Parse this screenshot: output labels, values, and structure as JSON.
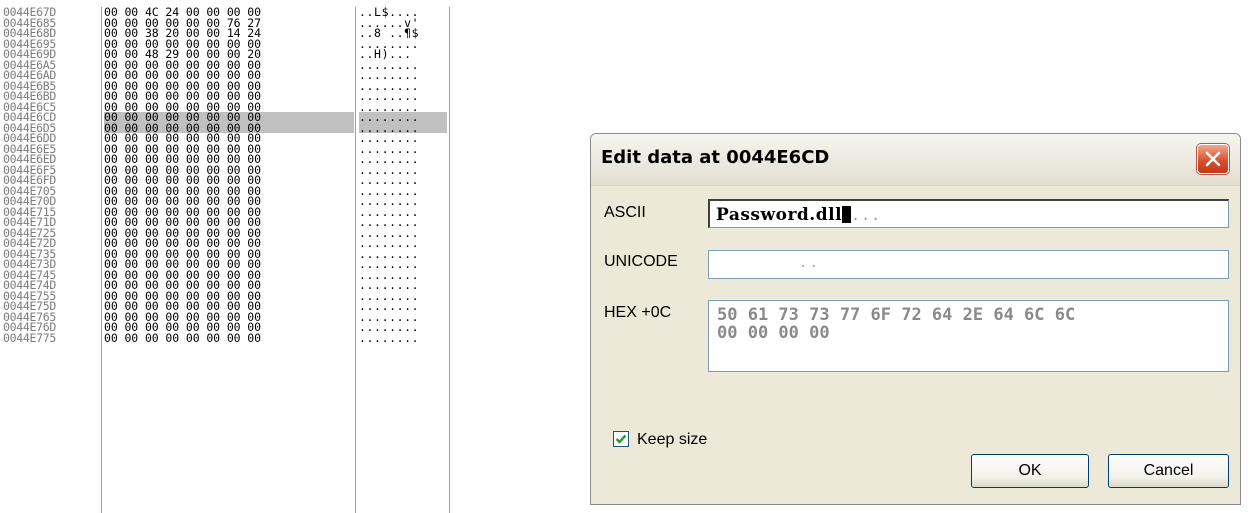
{
  "hex_dump": {
    "rows": [
      {
        "addr": "0044E67D",
        "hex": "00 00 4C 24 00 00 00 00",
        "ascii": "..L$....",
        "selected": false
      },
      {
        "addr": "0044E685",
        "hex": "00 00 00 00 00 00 76 27",
        "ascii": "......v'",
        "selected": false
      },
      {
        "addr": "0044E68D",
        "hex": "00 00 38 20 00 00 14 24",
        "ascii": "..8 ..¶$",
        "selected": false
      },
      {
        "addr": "0044E695",
        "hex": "00 00 00 00 00 00 00 00",
        "ascii": "........",
        "selected": false
      },
      {
        "addr": "0044E69D",
        "hex": "00 00 48 29 00 00 00 20",
        "ascii": "..H)... ",
        "selected": false
      },
      {
        "addr": "0044E6A5",
        "hex": "00 00 00 00 00 00 00 00",
        "ascii": "........",
        "selected": false
      },
      {
        "addr": "0044E6AD",
        "hex": "00 00 00 00 00 00 00 00",
        "ascii": "........",
        "selected": false
      },
      {
        "addr": "0044E6B5",
        "hex": "00 00 00 00 00 00 00 00",
        "ascii": "........",
        "selected": false
      },
      {
        "addr": "0044E6BD",
        "hex": "00 00 00 00 00 00 00 00",
        "ascii": "........",
        "selected": false
      },
      {
        "addr": "0044E6C5",
        "hex": "00 00 00 00 00 00 00 00",
        "ascii": "........",
        "selected": false
      },
      {
        "addr": "0044E6CD",
        "hex": "00 00 00 00 00 00 00 00",
        "ascii": "........",
        "selected": true
      },
      {
        "addr": "0044E6D5",
        "hex": "00 00 00 00 00 00 00 00",
        "ascii": "........",
        "selected": true
      },
      {
        "addr": "0044E6DD",
        "hex": "00 00 00 00 00 00 00 00",
        "ascii": "........",
        "selected": false
      },
      {
        "addr": "0044E6E5",
        "hex": "00 00 00 00 00 00 00 00",
        "ascii": "........",
        "selected": false
      },
      {
        "addr": "0044E6ED",
        "hex": "00 00 00 00 00 00 00 00",
        "ascii": "........",
        "selected": false
      },
      {
        "addr": "0044E6F5",
        "hex": "00 00 00 00 00 00 00 00",
        "ascii": "........",
        "selected": false
      },
      {
        "addr": "0044E6FD",
        "hex": "00 00 00 00 00 00 00 00",
        "ascii": "........",
        "selected": false
      },
      {
        "addr": "0044E705",
        "hex": "00 00 00 00 00 00 00 00",
        "ascii": "........",
        "selected": false
      },
      {
        "addr": "0044E70D",
        "hex": "00 00 00 00 00 00 00 00",
        "ascii": "........",
        "selected": false
      },
      {
        "addr": "0044E715",
        "hex": "00 00 00 00 00 00 00 00",
        "ascii": "........",
        "selected": false
      },
      {
        "addr": "0044E71D",
        "hex": "00 00 00 00 00 00 00 00",
        "ascii": "........",
        "selected": false
      },
      {
        "addr": "0044E725",
        "hex": "00 00 00 00 00 00 00 00",
        "ascii": "........",
        "selected": false
      },
      {
        "addr": "0044E72D",
        "hex": "00 00 00 00 00 00 00 00",
        "ascii": "........",
        "selected": false
      },
      {
        "addr": "0044E735",
        "hex": "00 00 00 00 00 00 00 00",
        "ascii": "........",
        "selected": false
      },
      {
        "addr": "0044E73D",
        "hex": "00 00 00 00 00 00 00 00",
        "ascii": "........",
        "selected": false
      },
      {
        "addr": "0044E745",
        "hex": "00 00 00 00 00 00 00 00",
        "ascii": "........",
        "selected": false
      },
      {
        "addr": "0044E74D",
        "hex": "00 00 00 00 00 00 00 00",
        "ascii": "........",
        "selected": false
      },
      {
        "addr": "0044E755",
        "hex": "00 00 00 00 00 00 00 00",
        "ascii": "........",
        "selected": false
      },
      {
        "addr": "0044E75D",
        "hex": "00 00 00 00 00 00 00 00",
        "ascii": "........",
        "selected": false
      },
      {
        "addr": "0044E765",
        "hex": "00 00 00 00 00 00 00 00",
        "ascii": "........",
        "selected": false
      },
      {
        "addr": "0044E76D",
        "hex": "00 00 00 00 00 00 00 00",
        "ascii": "........",
        "selected": false
      },
      {
        "addr": "0044E775",
        "hex": "00 00 00 00 00 00 00 00",
        "ascii": "........",
        "selected": false
      }
    ]
  },
  "dialog": {
    "title": "Edit data at 0044E6CD",
    "ascii_label": "ASCII",
    "ascii_value": "Password.dll",
    "ascii_trailing": "...",
    "unicode_label": "UNICODE",
    "unicode_value": "..",
    "hex_label": "HEX +0C",
    "hex_value": "50 61 73 73 77 6F 72 64 2E 64 6C 6C\n00 00 00 00",
    "keep_size_label": "Keep size",
    "keep_size_checked": true,
    "ok_label": "OK",
    "cancel_label": "Cancel"
  }
}
